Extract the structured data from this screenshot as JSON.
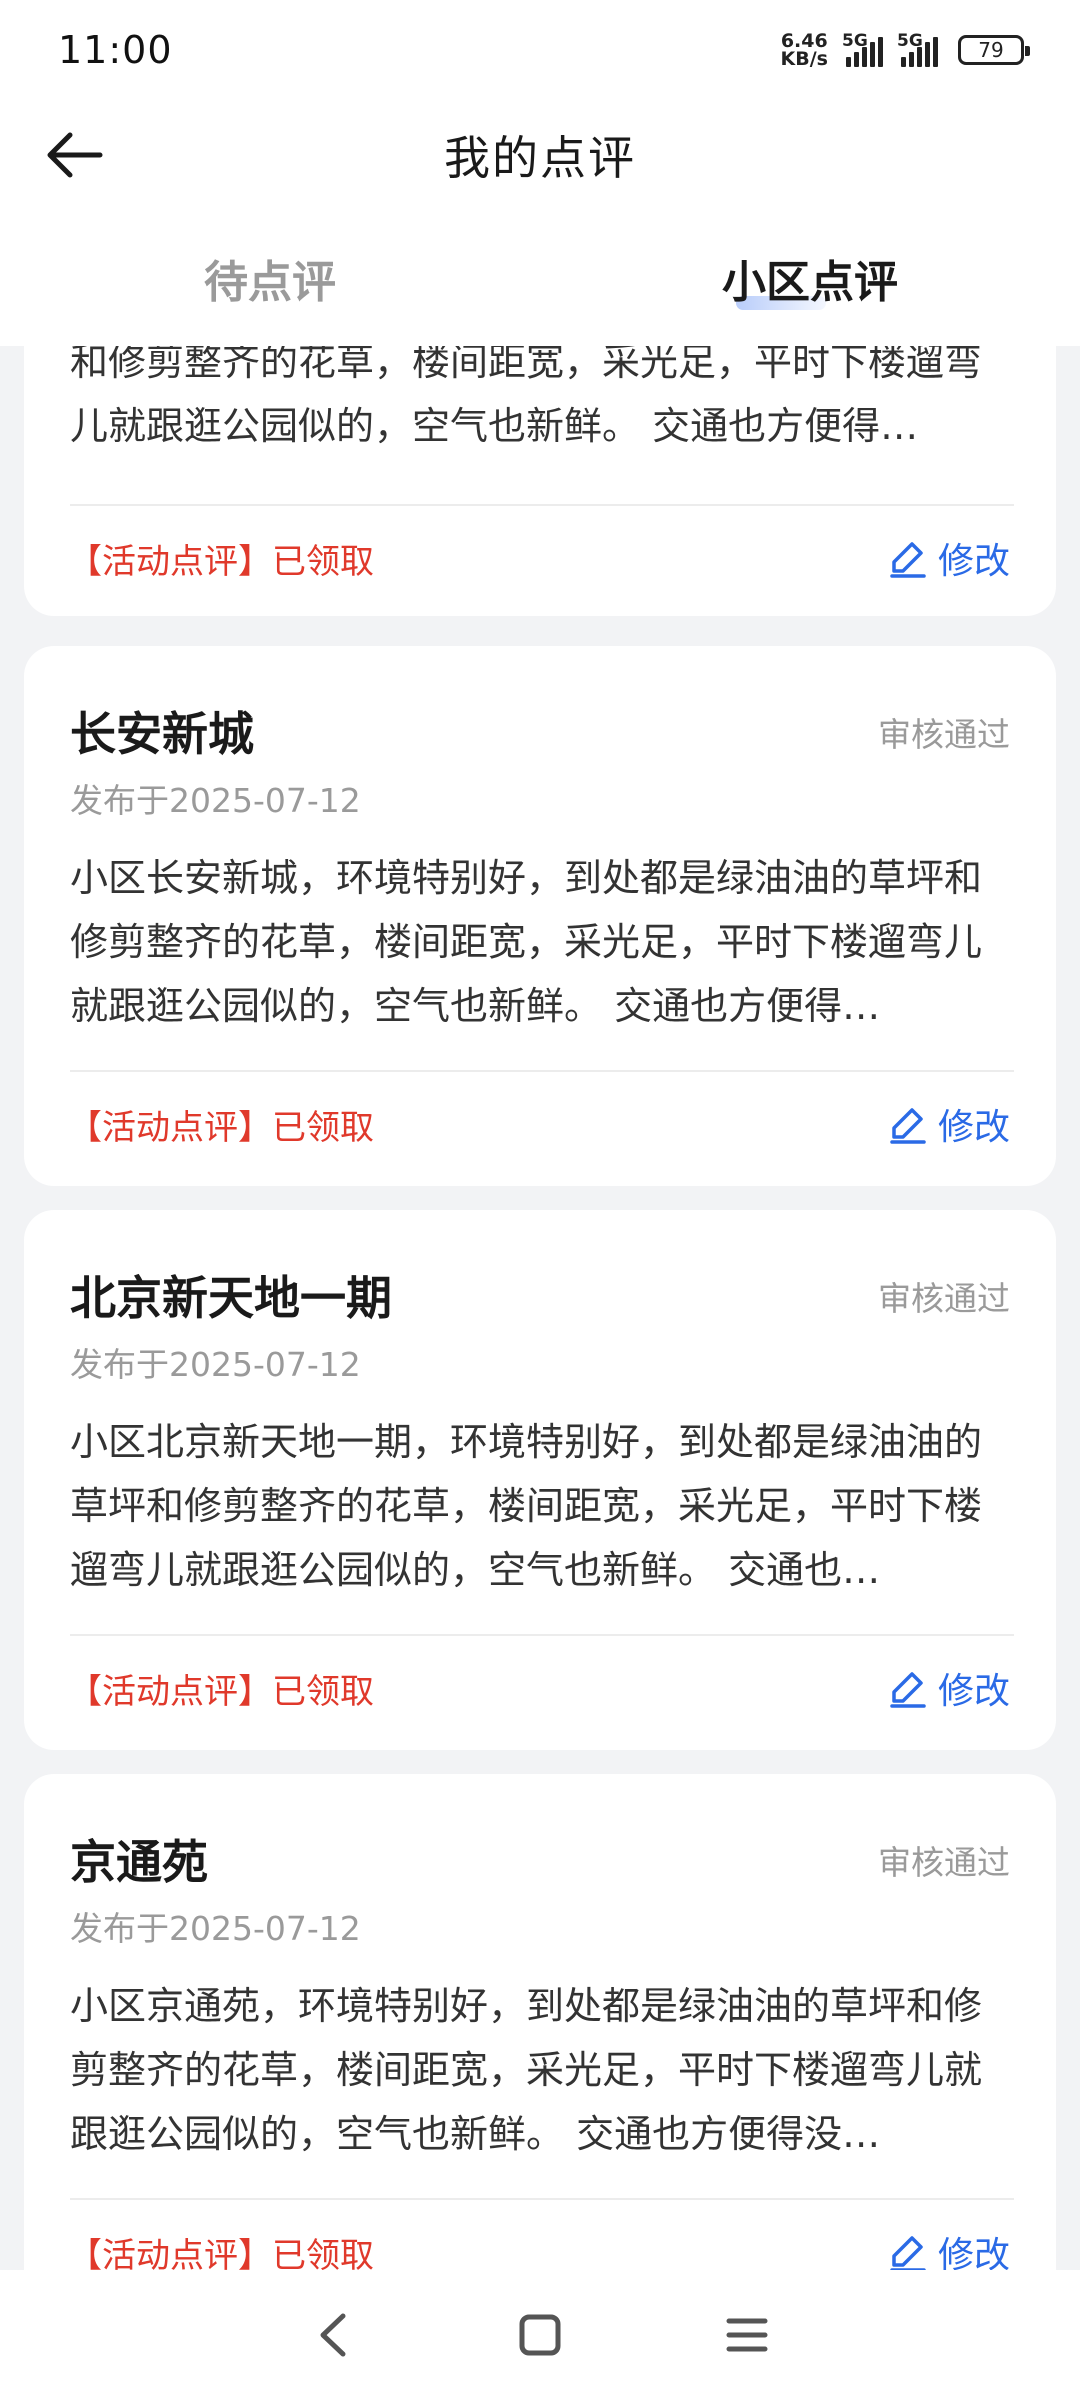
{
  "status_bar": {
    "time": "11:00",
    "net_speed_value": "6.46",
    "net_speed_unit": "KB/s",
    "signal1_label": "5G",
    "signal2_label": "5G",
    "battery": "79"
  },
  "header": {
    "title": "我的点评"
  },
  "tabs": [
    {
      "label": "待点评",
      "active": false
    },
    {
      "label": "小区点评",
      "active": true
    }
  ],
  "partial_card": {
    "body": "和修剪整齐的花草，楼间距宽，采光足，平时下楼遛弯儿就跟逛公园似的，空气也新鲜。 交通也方便得…",
    "tag": "【活动点评】已领取",
    "edit_label": "修改"
  },
  "cards": [
    {
      "title": "长安新城",
      "status": "审核通过",
      "date": "发布于2025-07-12",
      "body": "小区长安新城，环境特别好，到处都是绿油油的草坪和修剪整齐的花草，楼间距宽，采光足，平时下楼遛弯儿就跟逛公园似的，空气也新鲜。 交通也方便得…",
      "tag": "【活动点评】已领取",
      "edit_label": "修改"
    },
    {
      "title": "北京新天地一期",
      "status": "审核通过",
      "date": "发布于2025-07-12",
      "body": "小区北京新天地一期，环境特别好，到处都是绿油油的草坪和修剪整齐的花草，楼间距宽，采光足，平时下楼遛弯儿就跟逛公园似的，空气也新鲜。 交通也…",
      "tag": "【活动点评】已领取",
      "edit_label": "修改"
    },
    {
      "title": "京通苑",
      "status": "审核通过",
      "date": "发布于2025-07-12",
      "body": "小区京通苑，环境特别好，到处都是绿油油的草坪和修剪整齐的花草，楼间距宽，采光足，平时下楼遛弯儿就跟逛公园似的，空气也新鲜。 交通也方便得没…",
      "tag": "【活动点评】已领取",
      "edit_label": "修改"
    }
  ],
  "nav": {
    "back_icon": "back-triangle-icon",
    "home_icon": "home-square-icon",
    "menu_icon": "menu-lines-icon"
  },
  "colors": {
    "accent": "#2a6ae6",
    "tag_red": "#e0392b",
    "muted": "#9a9a9a",
    "background": "#f2f3f5"
  }
}
